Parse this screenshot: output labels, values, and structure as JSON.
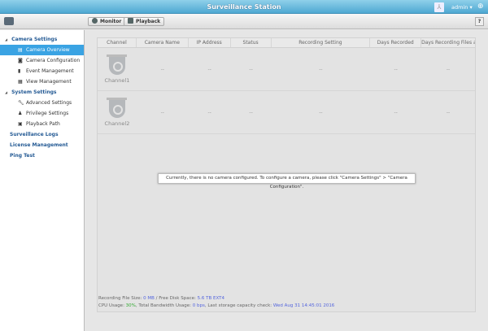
{
  "header": {
    "title": "Surveillance Station",
    "user": "admin"
  },
  "toolbar": {
    "monitor": "Monitor",
    "playback": "Playback",
    "help": "?"
  },
  "sidebar": {
    "camera_settings": "Camera Settings",
    "camera_items": [
      "Camera Overview",
      "Camera Configuration",
      "Event Management",
      "View Management"
    ],
    "system_settings": "System Settings",
    "system_items": [
      "Advanced Settings",
      "Privilege Settings",
      "Playback Path"
    ],
    "others": [
      "Surveillance Logs",
      "License Management",
      "Ping Test"
    ]
  },
  "table": {
    "columns": [
      "Channel",
      "Camera Name",
      "IP Address",
      "Status",
      "Recording Setting",
      "Days Recorded",
      "Days Recording Files ar..."
    ],
    "rows": [
      {
        "channel": "Channel1",
        "cells": [
          "--",
          "--",
          "--",
          "--",
          "--",
          "--"
        ]
      },
      {
        "channel": "Channel2",
        "cells": [
          "--",
          "--",
          "--",
          "--",
          "--",
          "--"
        ]
      }
    ]
  },
  "message": "Currently, there is no camera configured. To configure a camera, please click \"Camera Settings\" > \"Camera Configuration\".",
  "info": {
    "rec_label": "Recording File Size: ",
    "rec_value": "0 MB",
    "disk_label": " / Free Disk Space: ",
    "disk_value": "5.6 TB EXT4",
    "cpu_label": "CPU Usage: ",
    "cpu_value": "30%",
    "bw_label": ", Total Bandwidth Usage: ",
    "bw_value": "0 bps",
    "check_label": ", Last storage capacity check: ",
    "check_value": "Wed Aug 31 14:45:01 2016"
  }
}
